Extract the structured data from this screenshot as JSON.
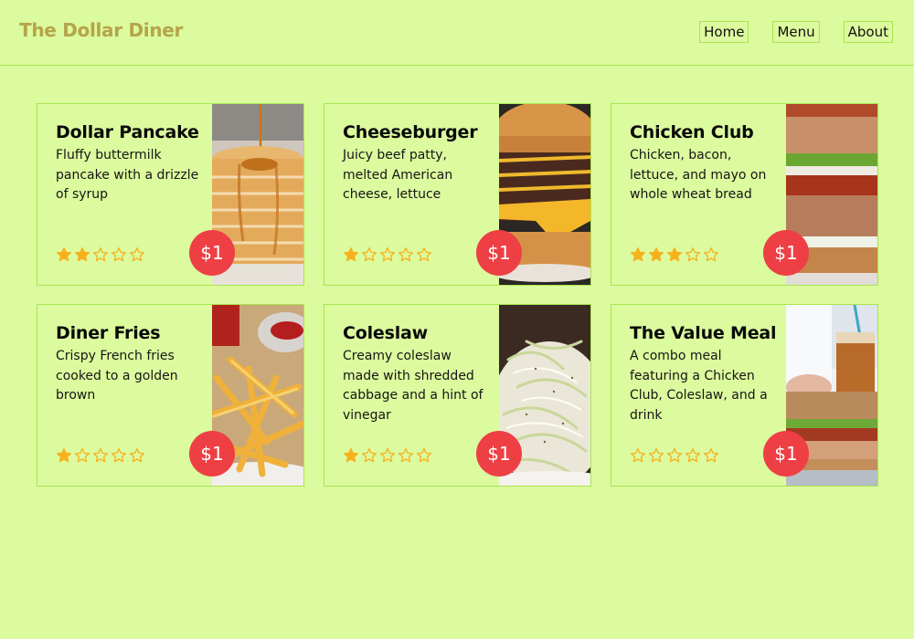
{
  "header": {
    "logo": "The Dollar Diner",
    "nav": [
      {
        "label": "Home"
      },
      {
        "label": "Menu"
      },
      {
        "label": "About"
      }
    ]
  },
  "colors": {
    "background": "#dcfa9e",
    "border": "#a8e64e",
    "logo": "#b5a44a",
    "price_badge": "#ee3f45",
    "star": "#f6b11d"
  },
  "menu": [
    {
      "name": "Dollar Pancake",
      "description": "Fluffy buttermilk pancake with a drizzle of syrup",
      "rating": 2,
      "max_rating": 5,
      "price": "$1",
      "image": "pancake-stack"
    },
    {
      "name": "Cheeseburger",
      "description": "Juicy beef patty, melted American cheese, lettuce",
      "rating": 1,
      "max_rating": 5,
      "price": "$1",
      "image": "cheeseburger"
    },
    {
      "name": "Chicken Club",
      "description": "Chicken, bacon, lettuce, and mayo on whole wheat bread",
      "rating": 3,
      "max_rating": 5,
      "price": "$1",
      "image": "club-sandwich"
    },
    {
      "name": "Diner Fries",
      "description": "Crispy French fries cooked to a golden brown",
      "rating": 1,
      "max_rating": 5,
      "price": "$1",
      "image": "french-fries"
    },
    {
      "name": "Coleslaw",
      "description": "Creamy coleslaw made with shredded cabbage and a hint of vinegar",
      "rating": 1,
      "max_rating": 5,
      "price": "$1",
      "image": "coleslaw"
    },
    {
      "name": "The Value Meal",
      "description": "A combo meal featuring a Chicken Club, Coleslaw, and a drink",
      "rating": 0,
      "max_rating": 5,
      "price": "$1",
      "image": "combo-meal"
    }
  ]
}
